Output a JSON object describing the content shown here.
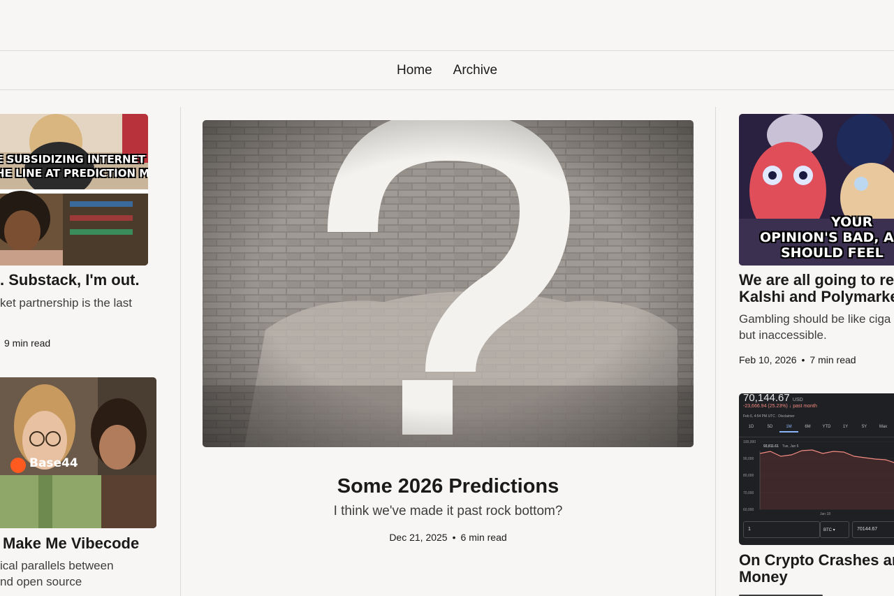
{
  "nav": {
    "home": "Home",
    "archive": "Archive"
  },
  "left_column": {
    "post1": {
      "meme_line1": "E SUBSIDIZING INTERNET NAZIS,",
      "meme_line2": "HE LINE AT PREDICTION MARKETS",
      "title": ". Substack, I'm out.",
      "subtitle": "ket partnership is the last",
      "read_time": "9 min read"
    },
    "post2": {
      "logo_text": "Base44",
      "title": "Make Me Vibecode",
      "subtitle_line1": "ical parallels between",
      "subtitle_line2": "nd open source"
    }
  },
  "featured": {
    "title": "Some 2026 Predictions",
    "subtitle": "I think we've made it past rock bottom?",
    "date": "Dec 21, 2025",
    "read_time": "6 min read",
    "image_icon": "question-mark-graffiti"
  },
  "right_column": {
    "post1": {
      "meme_line1": "YOUR",
      "meme_line2": "OPINION'S BAD, A",
      "meme_line3": "SHOULD FEEL",
      "title_line1": "We are all going to reg",
      "title_line2": "Kalshi and Polymarke",
      "subtitle": "Gambling should be like ciga but inaccessible.",
      "date": "Feb 10, 2026",
      "read_time": "7 min read"
    },
    "post2": {
      "price": "70,144.67",
      "currency": "USD",
      "change": "-23,666.94 (25.23%) ↓ past month",
      "timestamp": "Feb 6, 4:54 PM UTC · Disclaimer",
      "ranges": [
        "1D",
        "5D",
        "1M",
        "6M",
        "YTD",
        "1Y",
        "5Y",
        "Max"
      ],
      "active_range": "1M",
      "y_ticks": [
        "100,000",
        "90,000",
        "80,000",
        "70,000",
        "60,000"
      ],
      "tooltip_value": "93,811.61",
      "tooltip_date": "Tue, Jan 6",
      "x_tick": "Jan 18",
      "input_amount": "1",
      "input_currency": "BTC",
      "input_converted": "70144.67",
      "title_line1": "On Crypto Crashes ar",
      "title_line2": "Money"
    }
  },
  "colors": {
    "background": "#f8f6f4",
    "divider": "#dcd9d6",
    "text": "#1a1a1a"
  }
}
